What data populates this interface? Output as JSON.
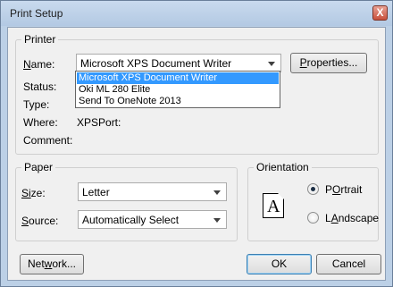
{
  "window": {
    "title": "Print Setup",
    "close_glyph": "X"
  },
  "printer_group": {
    "label": "Printer",
    "name_label": "Name:",
    "name_accel": "N",
    "name_rest": "ame:",
    "selected_printer": "Microsoft XPS Document Writer",
    "properties_label": "Properties...",
    "properties_accel": "P",
    "properties_rest": "roperties...",
    "status_label": "Status:",
    "type_label": "Type:",
    "where_label": "Where:",
    "where_value": "XPSPort:",
    "comment_label": "Comment:",
    "dropdown_items": [
      "Microsoft XPS Document Writer",
      "Oki ML 280 Elite",
      "Send To OneNote 2013"
    ]
  },
  "paper_group": {
    "label": "Paper",
    "size_accel": "Si",
    "size_rest": "ze:",
    "size_value": "Letter",
    "source_accel": "S",
    "source_rest": "ource:",
    "source_value": "Automatically Select"
  },
  "orientation_group": {
    "label": "Orientation",
    "icon_letter": "A",
    "portrait_accel": "O",
    "portrait_rest": "rtrait",
    "portrait_pre": "P",
    "landscape_accel": "A",
    "landscape_pre": "L",
    "landscape_rest": "ndscape",
    "landscape_mid": "a",
    "selected": "Portrait"
  },
  "buttons": {
    "network_pre": "Net",
    "network_accel": "w",
    "network_rest": "ork...",
    "ok": "OK",
    "cancel": "Cancel"
  },
  "colors": {
    "accent_selection": "#3399ff",
    "frame": "#bcd0e6"
  }
}
